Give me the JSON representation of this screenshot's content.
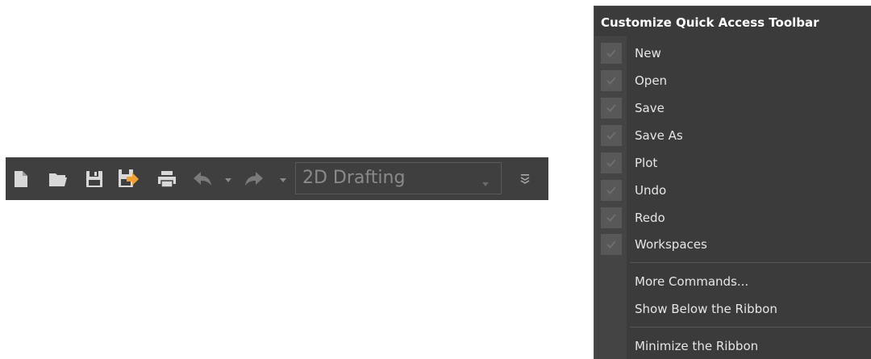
{
  "toolbar": {
    "buttons": [
      {
        "name": "new-button",
        "icon": "new-document-icon"
      },
      {
        "name": "open-button",
        "icon": "open-folder-icon"
      },
      {
        "name": "save-button",
        "icon": "save-icon"
      },
      {
        "name": "save-as-button",
        "icon": "save-as-icon"
      },
      {
        "name": "plot-button",
        "icon": "printer-icon"
      },
      {
        "name": "undo-button",
        "icon": "undo-arrow-icon"
      },
      {
        "name": "redo-button",
        "icon": "redo-arrow-icon"
      }
    ],
    "workspace": {
      "value": "2D Drafting"
    },
    "colors": {
      "background": "#3f3f3f",
      "icon": "#d8d8d8",
      "accent": "#f0a030",
      "disabled": "#7a7a7a"
    }
  },
  "menu": {
    "title": "Customize Quick Access Toolbar",
    "items": [
      {
        "label": "New",
        "checked": true
      },
      {
        "label": "Open",
        "checked": true
      },
      {
        "label": "Save",
        "checked": true
      },
      {
        "label": "Save As",
        "checked": true
      },
      {
        "label": "Plot",
        "checked": true
      },
      {
        "label": "Undo",
        "checked": true
      },
      {
        "label": "Redo",
        "checked": true
      },
      {
        "label": "Workspaces",
        "checked": true
      }
    ],
    "more_commands": "More Commands...",
    "show_below": "Show Below the Ribbon",
    "minimize": "Minimize the Ribbon",
    "colors": {
      "background": "#3b3b3b",
      "check_box": "#585858"
    }
  }
}
